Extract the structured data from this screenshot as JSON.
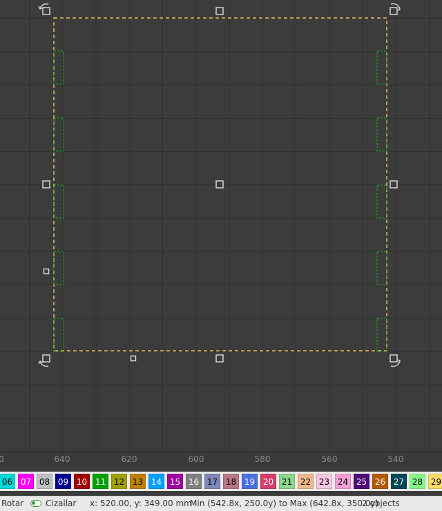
{
  "ruler": {
    "ticks": [
      "0",
      "640",
      "620",
      "600",
      "580",
      "560",
      "540"
    ]
  },
  "palette": {
    "swatches": [
      {
        "label": "06",
        "color": "#00d7d7",
        "text": "#000000"
      },
      {
        "label": "07",
        "color": "#ff00ff",
        "text": "#ffffff"
      },
      {
        "label": "08",
        "color": "#c0c0c0",
        "text": "#000000"
      },
      {
        "label": "09",
        "color": "#000090",
        "text": "#ffffff"
      },
      {
        "label": "10",
        "color": "#a00000",
        "text": "#ffffff"
      },
      {
        "label": "11",
        "color": "#00a000",
        "text": "#ffffff"
      },
      {
        "label": "12",
        "color": "#a0a000",
        "text": "#000000"
      },
      {
        "label": "13",
        "color": "#c08000",
        "text": "#000000"
      },
      {
        "label": "14",
        "color": "#00a0ff",
        "text": "#ffffff"
      },
      {
        "label": "15",
        "color": "#a000a0",
        "text": "#ffffff"
      },
      {
        "label": "16",
        "color": "#808080",
        "text": "#ffffff"
      },
      {
        "label": "17",
        "color": "#7d87b9",
        "text": "#000000"
      },
      {
        "label": "18",
        "color": "#bb7784",
        "text": "#000000"
      },
      {
        "label": "19",
        "color": "#4a6fe3",
        "text": "#ffffff"
      },
      {
        "label": "20",
        "color": "#d33f6a",
        "text": "#ffffff"
      },
      {
        "label": "21",
        "color": "#8cd78c",
        "text": "#000000"
      },
      {
        "label": "22",
        "color": "#f0b98d",
        "text": "#000000"
      },
      {
        "label": "23",
        "color": "#f6c4e1",
        "text": "#000000"
      },
      {
        "label": "24",
        "color": "#fa9ed4",
        "text": "#000000"
      },
      {
        "label": "25",
        "color": "#500a78",
        "text": "#ffffff"
      },
      {
        "label": "26",
        "color": "#b45a00",
        "text": "#ffffff"
      },
      {
        "label": "27",
        "color": "#004754",
        "text": "#ffffff"
      },
      {
        "label": "28",
        "color": "#86fa88",
        "text": "#000000"
      },
      {
        "label": "29",
        "color": "#ffdb66",
        "text": "#000000"
      }
    ]
  },
  "status": {
    "mode_label": "Rotar",
    "shear_label": "Cizallar",
    "coords": "x: 520.00, y: 349.00 mm",
    "bounds": "Min (542.8x, 250.0y) to Max (642.8x, 350.0y)",
    "selection_count": "2 objects"
  },
  "colors": {
    "selection_outline": "#e8c060",
    "tab_outline": "#20b020",
    "handle_stroke": "#e0e0e0"
  }
}
